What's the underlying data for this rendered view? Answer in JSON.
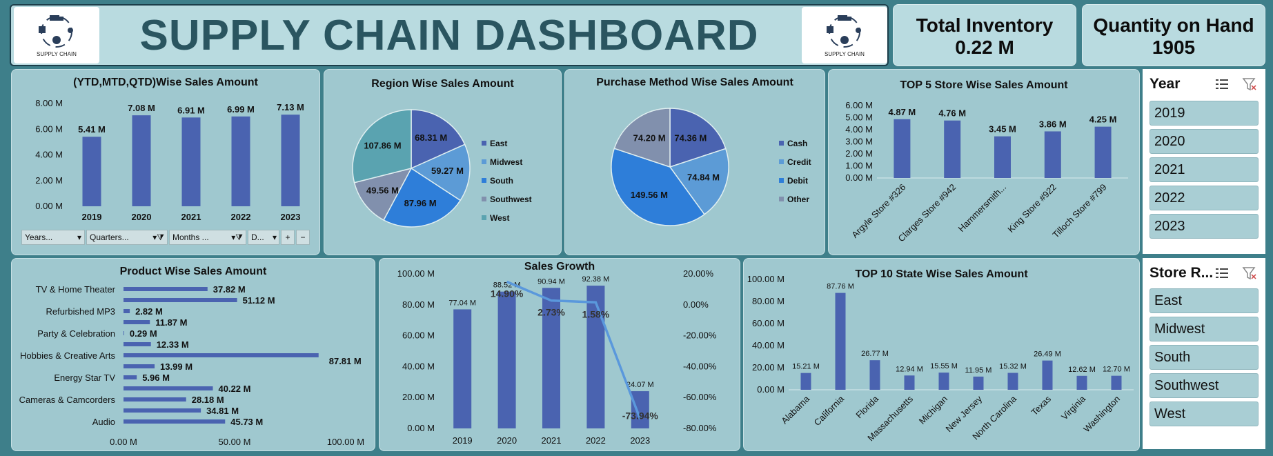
{
  "header": {
    "title": "SUPPLY CHAIN DASHBOARD",
    "logo_caption": "SUPPLY CHAIN"
  },
  "kpis": [
    {
      "label": "Total Inventory",
      "value": "0.22 M"
    },
    {
      "label": "Quantity on Hand",
      "value": "1905"
    }
  ],
  "slicers": {
    "year": {
      "title": "Year",
      "items": [
        "2019",
        "2020",
        "2021",
        "2022",
        "2023"
      ]
    },
    "region": {
      "title": "Store R...",
      "items": [
        "East",
        "Midwest",
        "South",
        "Southwest",
        "West"
      ]
    }
  },
  "filters": {
    "years": "Years...",
    "quarters": "Quarters...",
    "months": "Months ...",
    "d": "D...",
    "plus": "+",
    "minus": "−"
  },
  "colors": {
    "bar": "#4a63b0",
    "line": "#5a98dc",
    "panel": "#9fc8cf",
    "background": "#3e7f8a"
  },
  "chart_data": [
    {
      "id": "ytd",
      "type": "bar",
      "title": "(YTD,MTD,QTD)Wise Sales Amount",
      "categories": [
        "2019",
        "2020",
        "2021",
        "2022",
        "2023"
      ],
      "values": [
        5.41,
        7.08,
        6.91,
        6.99,
        7.13
      ],
      "labels": [
        "5.41 M",
        "7.08 M",
        "6.91 M",
        "6.99 M",
        "7.13 M"
      ],
      "yticks": [
        "0.00 M",
        "2.00 M",
        "4.00 M",
        "6.00 M",
        "8.00 M"
      ],
      "ylim": [
        0,
        8
      ]
    },
    {
      "id": "region",
      "type": "pie",
      "title": "Region Wise Sales Amount",
      "categories": [
        "East",
        "Midwest",
        "South",
        "Southwest",
        "West"
      ],
      "values": [
        68.31,
        59.27,
        87.96,
        49.56,
        107.86
      ],
      "labels": [
        "68.31 M",
        "59.27 M",
        "87.96 M",
        "49.56 M",
        "107.86 M"
      ],
      "colors": [
        "#4a63b0",
        "#5c9bd6",
        "#2e7ed9",
        "#8190ad",
        "#5aa3b0"
      ]
    },
    {
      "id": "purchase",
      "type": "pie",
      "title": "Purchase Method Wise Sales Amount",
      "categories": [
        "Cash",
        "Credit",
        "Debit",
        "Other"
      ],
      "values": [
        74.36,
        74.84,
        149.56,
        74.2
      ],
      "labels": [
        "74.36 M",
        "74.84 M",
        "149.56 M",
        "74.20 M"
      ],
      "colors": [
        "#4a63b0",
        "#5c9bd6",
        "#2e7ed9",
        "#8190ad"
      ]
    },
    {
      "id": "store",
      "type": "bar",
      "title": "TOP 5 Store Wise Sales Amount",
      "categories": [
        "Argyle Store #326",
        "Clarges Store #942",
        "Hammersmith...",
        "King Store #922",
        "Tilloch Store #799"
      ],
      "values": [
        4.87,
        4.76,
        3.45,
        3.86,
        4.25
      ],
      "labels": [
        "4.87 M",
        "4.76 M",
        "3.45 M",
        "3.86 M",
        "4.25 M"
      ],
      "yticks": [
        "0.00 M",
        "1.00 M",
        "2.00 M",
        "3.00 M",
        "4.00 M",
        "5.00 M",
        "6.00 M"
      ],
      "ylim": [
        0,
        6
      ]
    },
    {
      "id": "product",
      "type": "bar",
      "orientation": "horizontal",
      "title": "Product Wise Sales Amount",
      "categories": [
        "TV & Home Theater",
        "",
        "Refurbished MP3",
        "",
        "Party & Celebration",
        "",
        "Hobbies & Creative Arts",
        "",
        "Energy Star TV",
        "",
        "Cameras & Camcorders",
        "",
        "",
        "Audio"
      ],
      "values": [
        37.82,
        51.12,
        2.82,
        11.87,
        0.29,
        12.33,
        87.81,
        13.99,
        5.96,
        40.22,
        28.18,
        34.81,
        45.73
      ],
      "labels": [
        "37.82 M",
        "51.12 M",
        "2.82 M",
        "11.87 M",
        "0.29 M",
        "12.33 M",
        "87.81 M",
        "13.99 M",
        "5.96 M",
        "40.22 M",
        "28.18 M",
        "34.81 M",
        "45.73 M"
      ],
      "xticks": [
        "0.00 M",
        "50.00 M",
        "100.00 M"
      ],
      "xlim": [
        0,
        100
      ]
    },
    {
      "id": "growth",
      "type": "bar",
      "title": "Sales Growth",
      "categories": [
        "2019",
        "2020",
        "2021",
        "2022",
        "2023"
      ],
      "values": [
        77.04,
        88.52,
        90.94,
        92.38,
        24.07
      ],
      "labels": [
        "77.04 M",
        "88.52 M",
        "90.94 M",
        "92.38 M",
        "24.07 M"
      ],
      "yticks": [
        "0.00 M",
        "20.00 M",
        "40.00 M",
        "60.00 M",
        "80.00 M",
        "100.00 M"
      ],
      "ylim": [
        0,
        100
      ],
      "growth": [
        14.9,
        2.73,
        1.58,
        -73.94
      ],
      "growth_labels": [
        "14.90%",
        "2.73%",
        "1.58%",
        "-73.94%"
      ],
      "y2ticks": [
        "20.00%",
        "0.00%",
        "-20.00%",
        "-40.00%",
        "-60.00%",
        "-80.00%"
      ],
      "y2lim": [
        -80,
        20
      ]
    },
    {
      "id": "state",
      "type": "bar",
      "title": "TOP 10 State Wise Sales Amount",
      "categories": [
        "Alabama",
        "California",
        "Florida",
        "Massachusetts",
        "Michigan",
        "New Jersey",
        "North Carolina",
        "Texas",
        "Virginia",
        "Washington"
      ],
      "values": [
        15.21,
        87.76,
        26.77,
        12.94,
        15.55,
        11.95,
        15.32,
        26.49,
        12.62,
        12.7
      ],
      "labels": [
        "15.21 M",
        "87.76 M",
        "26.77 M",
        "12.94 M",
        "15.55 M",
        "11.95 M",
        "15.32 M",
        "26.49 M",
        "12.62 M",
        "12.70 M"
      ],
      "yticks": [
        "0.00 M",
        "20.00 M",
        "40.00 M",
        "60.00 M",
        "80.00 M",
        "100.00 M"
      ],
      "ylim": [
        0,
        100
      ]
    }
  ]
}
